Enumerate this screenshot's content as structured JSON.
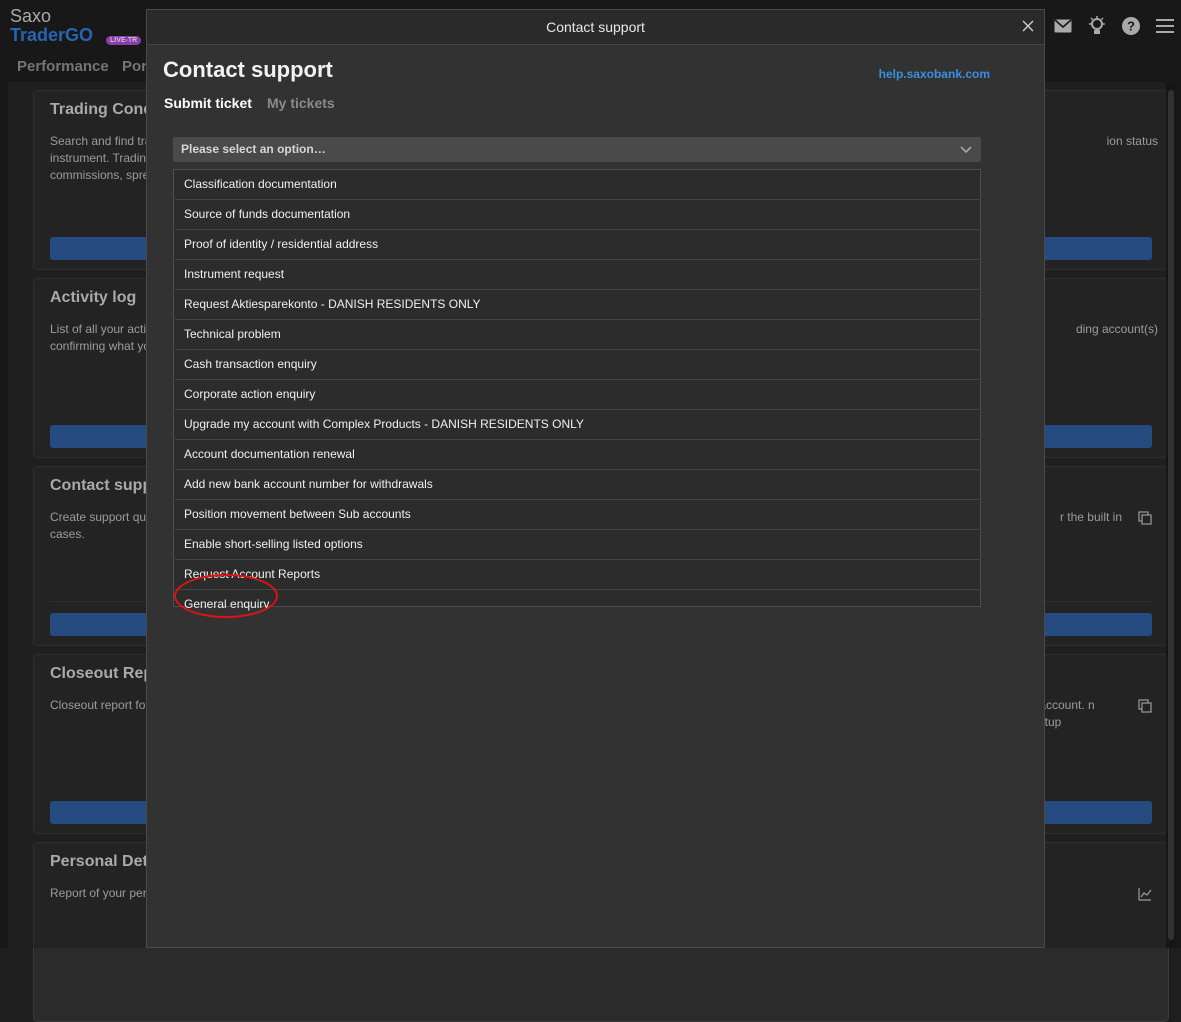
{
  "app": {
    "logo_top": "Saxo",
    "logo_bottom": "TraderGO",
    "badge": "LIVE-TR",
    "subnav": [
      "Performance",
      "Por"
    ]
  },
  "background_cards": [
    {
      "title": "Trading Cond",
      "desc": "Search and find tra instrument. Tradin commissions, spre",
      "right": "ion status",
      "icon": ""
    },
    {
      "title": "Activity log",
      "desc": "List of all your acti confirming what yo",
      "right": "ding account(s)",
      "icon": ""
    },
    {
      "title": "Contact supp",
      "desc": "Create support qu cases.",
      "right": "r the built in",
      "icon": "copy-icon"
    },
    {
      "title": "Closeout Rep",
      "desc": "Closeout report fo",
      "right": "r account. n setup",
      "icon": "copy-icon"
    },
    {
      "title": "Personal Deta",
      "desc": "Report of your per",
      "right": "",
      "icon": "chart-icon"
    }
  ],
  "modal": {
    "header_title": "Contact support",
    "title": "Contact support",
    "help_link": "help.saxobank.com",
    "tabs": [
      {
        "label": "Submit ticket",
        "active": true
      },
      {
        "label": "My tickets",
        "active": false
      }
    ],
    "select_placeholder": "Please select an option…",
    "options": [
      "Classification documentation",
      "Source of funds documentation",
      "Proof of identity / residential address",
      "Instrument request",
      "Request Aktiesparekonto - DANISH RESIDENTS ONLY",
      "Technical problem",
      "Cash transaction enquiry",
      "Corporate action enquiry",
      "Upgrade my account with Complex Products - DANISH RESIDENTS ONLY",
      "Account documentation renewal",
      "Add new bank account number for withdrawals",
      "Position movement between Sub accounts",
      "Enable short-selling listed options",
      "Request Account Reports",
      "General enquiry"
    ]
  },
  "colors": {
    "accent_blue": "#2f7cd8",
    "link_blue": "#3a8fe0",
    "highlight_red": "#e01212"
  }
}
